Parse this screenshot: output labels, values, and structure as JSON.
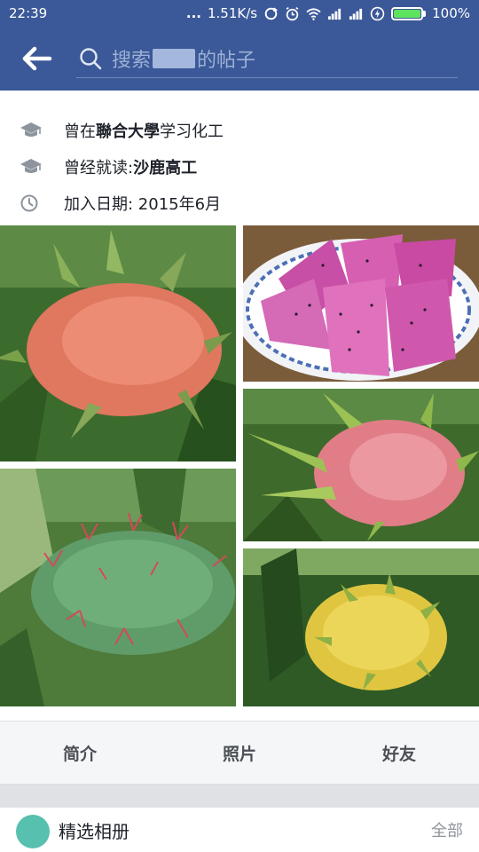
{
  "status_bar": {
    "time": "22:39",
    "dots": "...",
    "network_speed": "1.51K/s",
    "battery": "100%"
  },
  "header": {
    "search_prefix": "搜索",
    "search_suffix": "的帖子",
    "accent": "#3b5998"
  },
  "profile_info": {
    "education_1": {
      "prefix": "曾在",
      "school": "聯合大學",
      "suffix": "学习化工"
    },
    "education_2": {
      "prefix": "曾经就读: ",
      "school": "沙鹿高工"
    },
    "joined": "加入日期: 2015年6月"
  },
  "photos": [
    {
      "icon": "pink-dragon-fruit-photo"
    },
    {
      "icon": "sliced-purple-dragon-fruit-photo"
    },
    {
      "icon": "pink-dragon-fruit-photo"
    },
    {
      "icon": "green-cactus-fruit-photo"
    },
    {
      "icon": "yellow-dragon-fruit-photo"
    }
  ],
  "tabs": [
    {
      "label": "简介"
    },
    {
      "label": "照片"
    },
    {
      "label": "好友"
    }
  ],
  "album": {
    "title": "精选相册",
    "see_all": "全部"
  }
}
